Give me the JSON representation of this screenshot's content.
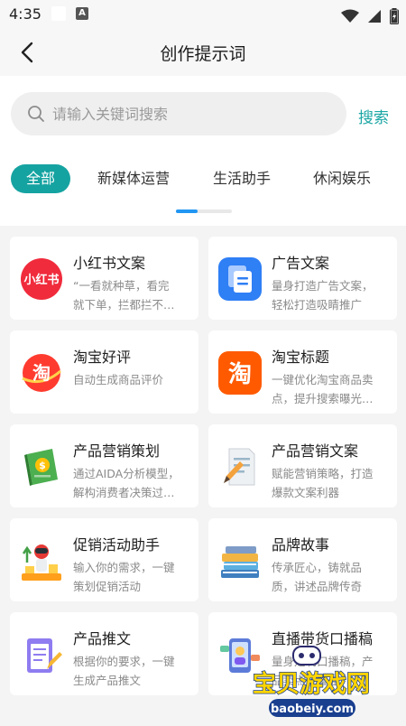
{
  "status_bar": {
    "time": "4:35",
    "app_badge": "A"
  },
  "header": {
    "title": "创作提示词"
  },
  "search": {
    "placeholder": "请输入关键词搜索",
    "button_label": "搜索"
  },
  "tabs": [
    {
      "label": "全部",
      "active": true
    },
    {
      "label": "新媒体运营",
      "active": false
    },
    {
      "label": "生活助手",
      "active": false
    },
    {
      "label": "休闲娱乐",
      "active": false
    }
  ],
  "cards": [
    {
      "title": "小红书文案",
      "desc": [
        "“一看就种草，看完",
        "就下单，拦都拦不…"
      ],
      "icon": "xiaohongshu-icon"
    },
    {
      "title": "广告文案",
      "desc": [
        "量身打造广告文案，",
        "轻松打造吸睛推广"
      ],
      "icon": "document-stack-icon"
    },
    {
      "title": "淘宝好评",
      "desc": [
        "自动生成商品评价"
      ],
      "icon": "taobao-icon"
    },
    {
      "title": "淘宝标题",
      "desc": [
        "一键优化淘宝商品卖",
        "点，提升搜索曝光…"
      ],
      "icon": "taobao-orange-icon"
    },
    {
      "title": "产品营销策划",
      "desc": [
        "通过AIDA分析模型，",
        "解构消费者决策过…"
      ],
      "icon": "money-book-icon"
    },
    {
      "title": "产品营销文案",
      "desc": [
        "赋能营销策略，打造",
        "爆款文案利器"
      ],
      "icon": "document-pen-icon"
    },
    {
      "title": "促销活动助手",
      "desc": [
        "输入你的需求，一键",
        "策划促销活动"
      ],
      "icon": "promotion-robot-icon"
    },
    {
      "title": "品牌故事",
      "desc": [
        "传承匠心，铸就品",
        "质，讲述品牌传奇"
      ],
      "icon": "books-icon"
    },
    {
      "title": "产品推文",
      "desc": [
        "根据你的要求，一键",
        "生成产品推文"
      ],
      "icon": "notepad-pen-icon"
    },
    {
      "title": "直播带货口播稿",
      "desc": [
        "量身定制口播稿，产",
        "品卖点全覆盖"
      ],
      "icon": "live-stream-phone-icon"
    }
  ],
  "watermark": {
    "text": "宝贝游戏网",
    "url_text": "baobeiy.com"
  },
  "colors": {
    "accent": "#15a3a1",
    "search_link": "#1aa6a4",
    "indicator": "#2196f3"
  }
}
